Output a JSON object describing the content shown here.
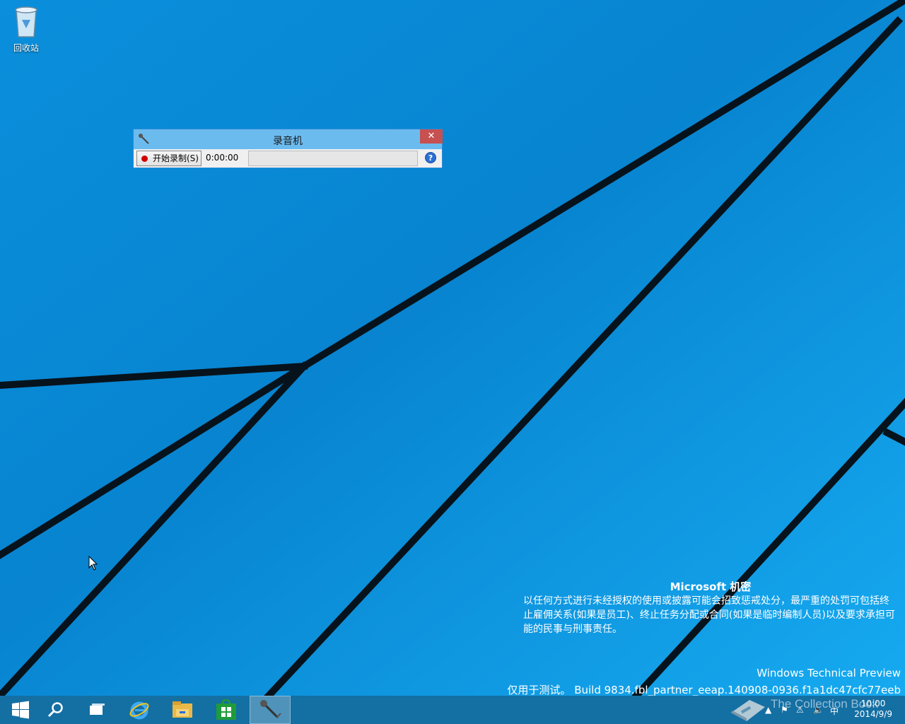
{
  "desktop": {
    "icons": [
      {
        "label": "回收站",
        "icon": "recycle-bin-icon"
      }
    ]
  },
  "recorder": {
    "title": "录音机",
    "close_label": "✕",
    "record_button_label": "开始录制(S)",
    "elapsed_time": "0:00:00",
    "help_label": "?"
  },
  "watermark": {
    "heading": "Microsoft 机密",
    "body": "以任何方式进行未经授权的使用或披露可能会招致惩戒处分，最严重的处罚可包括终止雇佣关系(如果是员工)、终止任务分配或合同(如果是临时编制人员)以及要求承担可能的民事与刑事责任。",
    "product": "Windows Technical Preview",
    "build": "仅用于测试。 Build 9834.fbl_partner_eeap.140908-0936.f1a1dc47cfc77eeb"
  },
  "taskbar": {
    "buttons": [
      {
        "name": "start-button",
        "icon": "windows-logo-icon"
      },
      {
        "name": "search-button",
        "icon": "search-icon"
      },
      {
        "name": "task-view-button",
        "icon": "task-view-icon"
      },
      {
        "name": "internet-explorer-button",
        "icon": "ie-icon"
      },
      {
        "name": "file-explorer-button",
        "icon": "folder-icon"
      },
      {
        "name": "store-button",
        "icon": "store-icon"
      },
      {
        "name": "sound-recorder-button",
        "icon": "microphone-icon",
        "active": true
      }
    ],
    "tray": {
      "ime": "中",
      "time": "10:00",
      "date": "2014/9/9"
    }
  },
  "overlay": {
    "collection_text": "The Collection Book"
  },
  "colors": {
    "desktop_bg": "#0b9de6",
    "taskbar_bg": "#146fa3",
    "titlebar_bg": "#6cbbef",
    "close_bg": "#c75050",
    "record_dot": "#d00000"
  }
}
